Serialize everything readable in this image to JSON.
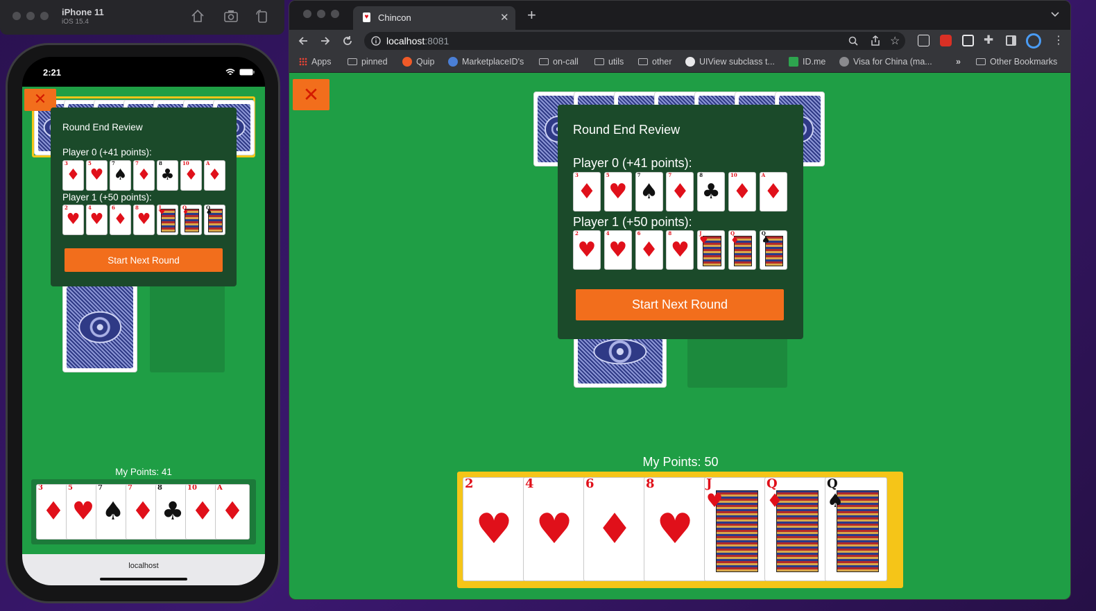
{
  "simulator": {
    "device": "iPhone 11",
    "os": "iOS 15.4"
  },
  "phone": {
    "time": "2:21",
    "url": "localhost"
  },
  "browser": {
    "tab_title": "Chincon",
    "url_host": "localhost",
    "url_port": ":8081",
    "bookmarks": [
      "Apps",
      "pinned",
      "Quip",
      "MarketplaceID's",
      "on-call",
      "utils",
      "other",
      "UIView subclass t...",
      "ID.me",
      "Visa for China (ma...",
      "Other Bookmarks"
    ],
    "overflow": "»"
  },
  "game_phone": {
    "modal_title": "Round End Review",
    "player0_label": "Player 0 (+41 points):",
    "player1_label": "Player 1 (+50 points):",
    "button": "Start Next Round",
    "points_label": "My Points: 41",
    "close": "✕"
  },
  "game_desktop": {
    "modal_title": "Round End Review",
    "player0_label": "Player 0 (+41 points):",
    "player1_label": "Player 1 (+50 points):",
    "button": "Start Next Round",
    "points_label": "My Points: 50",
    "close": "✕"
  },
  "cards": {
    "player0": [
      {
        "rank": "3",
        "suit": "♦"
      },
      {
        "rank": "5",
        "suit": "♥"
      },
      {
        "rank": "7",
        "suit": "♠"
      },
      {
        "rank": "7",
        "suit": "♦"
      },
      {
        "rank": "8",
        "suit": "♣"
      },
      {
        "rank": "10",
        "suit": "♦"
      },
      {
        "rank": "A",
        "suit": "♦"
      }
    ],
    "player1": [
      {
        "rank": "2",
        "suit": "♥"
      },
      {
        "rank": "4",
        "suit": "♥"
      },
      {
        "rank": "6",
        "suit": "♦"
      },
      {
        "rank": "8",
        "suit": "♥"
      },
      {
        "rank": "J",
        "suit": "♥"
      },
      {
        "rank": "Q",
        "suit": "♦"
      },
      {
        "rank": "Q",
        "suit": "♠"
      }
    ]
  },
  "colors": {
    "table": "#1f9e45",
    "modal": "#1b4a2a",
    "accent": "#f26e1c",
    "hand_border": "#f5c518"
  }
}
